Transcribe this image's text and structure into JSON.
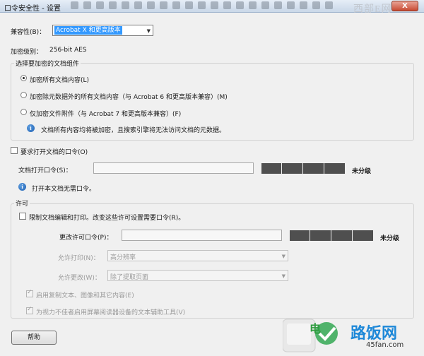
{
  "window": {
    "title": "口令安全性 - 设置",
    "close_label": "X"
  },
  "watermark": {
    "top_text": "西部E网",
    "bottom_brand": "路饭网",
    "bottom_url": "45fan.com",
    "bottom_partial": "电"
  },
  "compat": {
    "label": "兼容性(B)：",
    "value": "Acrobat X 和更高版本"
  },
  "encryption": {
    "label": "加密级别：",
    "value": "256-bit AES"
  },
  "components": {
    "legend": "选择要加密的文档组件",
    "options": [
      {
        "label": "加密所有文档内容(L)",
        "selected": true
      },
      {
        "label": "加密除元数据外的所有文档内容（与 Acrobat 6 和更高版本兼容）(M)",
        "selected": false
      },
      {
        "label": "仅加密文件附件（与 Acrobat 7 和更高版本兼容）(F)",
        "selected": false
      }
    ],
    "info": "文档所有内容均将被加密，且搜索引擎将无法访问文档的元数据。"
  },
  "open_password": {
    "checkbox_label": "要求打开文档的口令(O)",
    "field_label": "文档打开口令(S)：",
    "value": "",
    "strength": "未分级",
    "info": "打开本文档无需口令。"
  },
  "permissions": {
    "legend": "许可",
    "restrict_label": "限制文档编辑和打印。改变这些许可设置需要口令(R)。",
    "change_label": "更改许可口令(P)：",
    "change_value": "",
    "strength": "未分级",
    "print_label": "允许打印(N)：",
    "print_value": "高分辨率",
    "changes_label": "允许更改(W)：",
    "changes_value": "除了提取页面",
    "copy_label": "启用复制文本、图像和其它内容(E)",
    "access_label": "为视力不佳者启用屏幕阅读器设备的文本辅助工具(V)"
  },
  "help_label": "帮助"
}
